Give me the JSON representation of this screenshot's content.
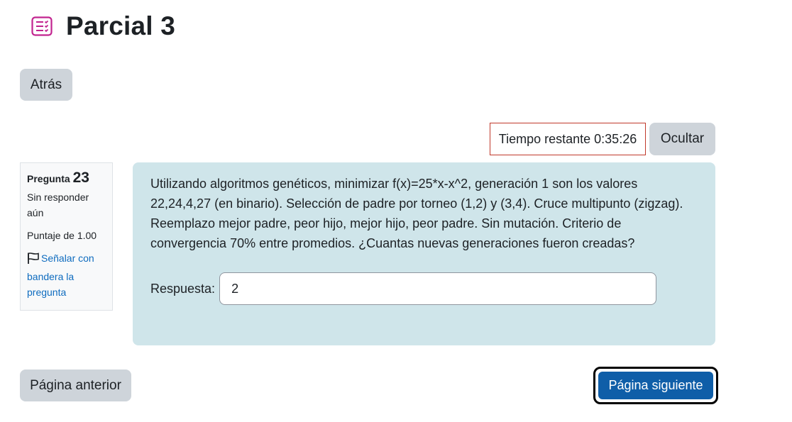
{
  "header": {
    "title": "Parcial 3",
    "icon": "quiz-icon",
    "icon_color": "#c2248f"
  },
  "nav": {
    "back_label": "Atrás"
  },
  "timer": {
    "text": "Tiempo restante 0:35:26",
    "hide_label": "Ocultar"
  },
  "question_info": {
    "label": "Pregunta",
    "number": "23",
    "state": "Sin responder aún",
    "grade": "Puntaje de 1.00",
    "flag_label": "Señalar con bandera la pregunta",
    "flag_icon": "flag-icon"
  },
  "question": {
    "text": "Utilizando algoritmos genéticos, minimizar f(x)=25*x-x^2, generación 1 son los valores 22,24,4,27 (en binario). Selección de padre por torneo (1,2) y (3,4). Cruce multipunto (zigzag). Reemplazo mejor padre, peor hijo, mejor hijo, peor padre. Sin mutación. Criterio de convergencia 70% entre promedios. ¿Cuantas nuevas generaciones fueron creadas?",
    "answer_label": "Respuesta:",
    "answer_value": "2",
    "background_color": "#cfe5ea"
  },
  "footer": {
    "prev_label": "Página anterior",
    "next_label": "Página siguiente",
    "next_color": "#0f5ea8"
  }
}
